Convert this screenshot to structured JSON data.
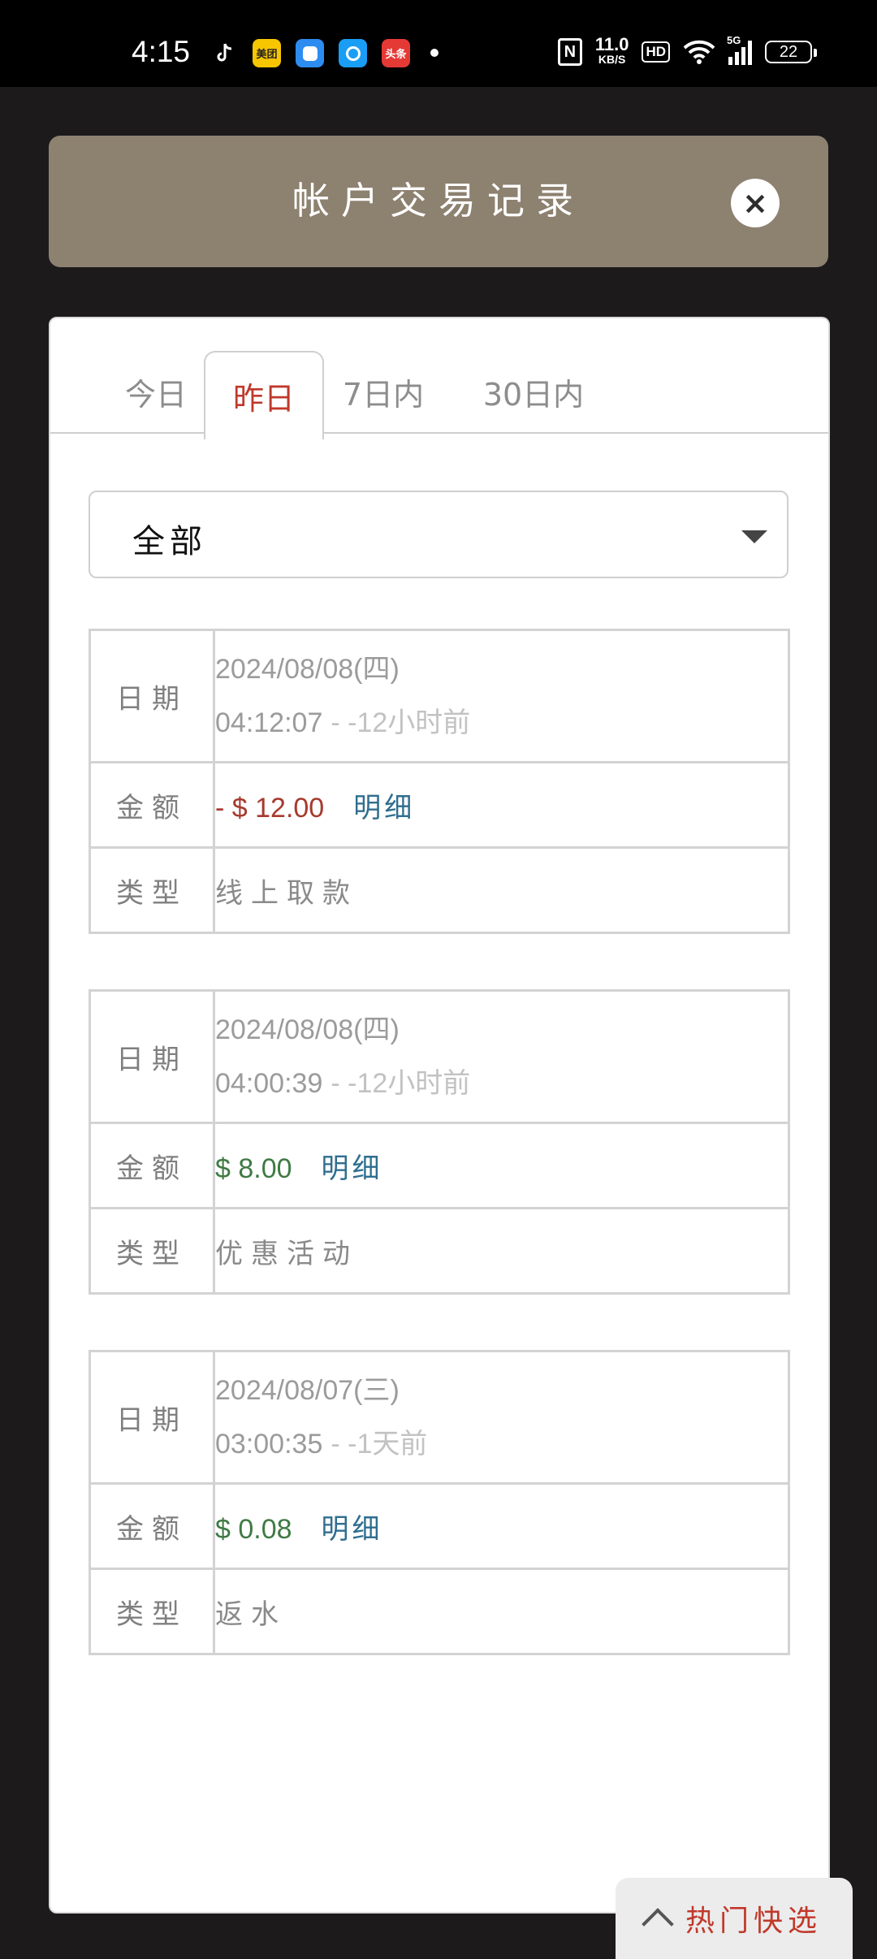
{
  "status_bar": {
    "time": "4:15",
    "speed_value": "11.0",
    "speed_unit": "KB/S",
    "hd": "HD",
    "network": "5G",
    "battery": "22",
    "app_icons": [
      "tiktok-icon",
      "meituan-icon",
      "blue-app-icon",
      "browser-icon",
      "toutiao-icon"
    ],
    "meituan_label": "美团",
    "toutiao_label": "头条"
  },
  "header": {
    "title": "帐户交易记录",
    "close_icon": "close-icon"
  },
  "tabs": [
    {
      "label": "今日",
      "active": false
    },
    {
      "label": "昨日",
      "active": true
    },
    {
      "label": "7日内",
      "active": false
    },
    {
      "label": "30日内",
      "active": false
    }
  ],
  "filter": {
    "selected": "全部"
  },
  "labels": {
    "date": "日期",
    "amount": "金额",
    "type": "类型",
    "detail": "明细"
  },
  "records": [
    {
      "date": "2024/08/08(四)",
      "time": "04:12:07",
      "ago": "- -12小时前",
      "amount": "- $ 12.00",
      "type": "线上取款",
      "sign": "negative"
    },
    {
      "date": "2024/08/08(四)",
      "time": "04:00:39",
      "ago": "- -12小时前",
      "amount": "$ 8.00",
      "type": "优惠活动",
      "sign": "positive"
    },
    {
      "date": "2024/08/07(三)",
      "time": "03:00:35",
      "ago": "- -1天前",
      "amount": "$ 0.08",
      "type": "返水",
      "sign": "positive"
    }
  ],
  "hot_button": {
    "label": "热门快选",
    "icon": "chevron-up-icon"
  },
  "colors": {
    "header_bg": "#8d8170",
    "active_tab": "#c0392b",
    "negative": "#a63a2e",
    "positive": "#3f7a44",
    "link": "#2f6e8f"
  }
}
